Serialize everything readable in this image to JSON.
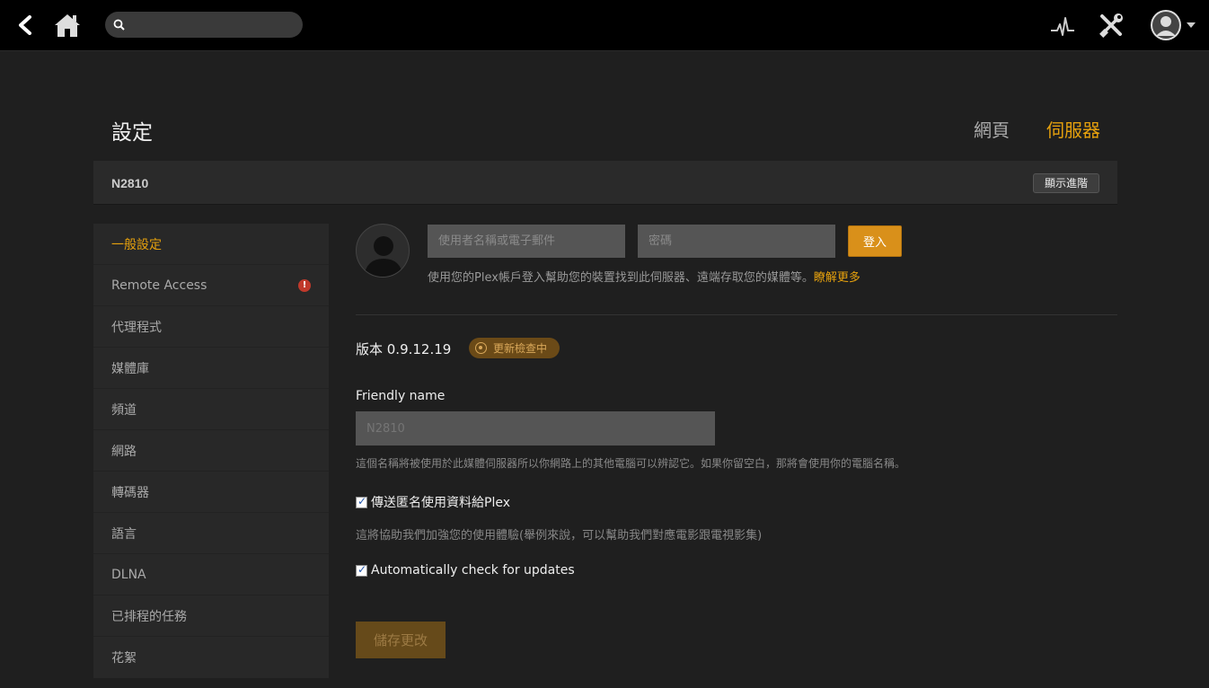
{
  "search": {
    "placeholder": ""
  },
  "header": {
    "title": "設定",
    "tabs": [
      {
        "label": "網頁",
        "active": false
      },
      {
        "label": "伺服器",
        "active": true
      }
    ]
  },
  "server": {
    "name": "N2810",
    "advanced_label": "顯示進階"
  },
  "sidebar": {
    "items": [
      {
        "label": "一般設定",
        "active": true
      },
      {
        "label": "Remote Access",
        "warning": true
      },
      {
        "label": "代理程式"
      },
      {
        "label": "媒體庫"
      },
      {
        "label": "頻道"
      },
      {
        "label": "網路"
      },
      {
        "label": "轉碼器"
      },
      {
        "label": "語言"
      },
      {
        "label": "DLNA"
      },
      {
        "label": "已排程的任務"
      },
      {
        "label": "花絮"
      }
    ]
  },
  "login": {
    "username_placeholder": "使用者名稱或電子郵件",
    "password_placeholder": "密碼",
    "button_label": "登入",
    "help_text": "使用您的Plex帳戶登入幫助您的裝置找到此伺服器、遠端存取您的媒體等。",
    "learn_more": "瞭解更多"
  },
  "version": {
    "label": "版本 0.9.12.19",
    "update_status": "更新檢查中"
  },
  "friendly_name": {
    "label": "Friendly name",
    "value": "",
    "placeholder": "N2810",
    "help": "這個名稱將被使用於此媒體伺服器所以你網路上的其他電腦可以辨認它。如果你留空白，那將會使用你的電腦名稱。"
  },
  "options": {
    "anon_label": "傳送匿名使用資料給Plex",
    "anon_help": "這將協助我們加強您的使用體驗(舉例來說，可以幫助我們對應電影跟電視影集)",
    "auto_update_label": "Automatically check for updates"
  },
  "save_label": "儲存更改",
  "colors": {
    "accent": "#e5a00d",
    "background": "#1f1f1f",
    "topbar": "#000000"
  }
}
